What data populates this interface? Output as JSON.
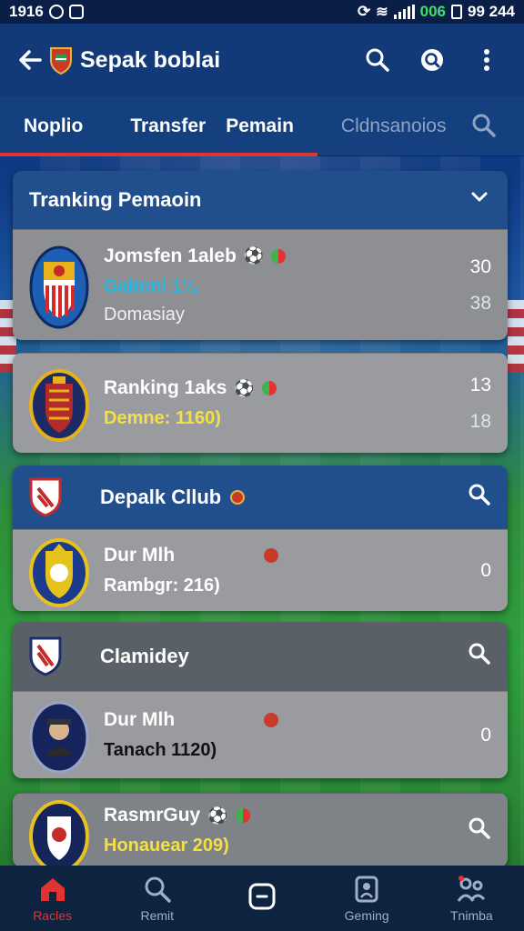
{
  "status_bar": {
    "time": "1916",
    "network": "006",
    "clock": "99 244"
  },
  "app_bar": {
    "title": "Sepak boblai"
  },
  "tabs": [
    {
      "label": "Noplio"
    },
    {
      "label": "Transfer"
    },
    {
      "label": "Pemain"
    },
    {
      "label": "Cldnsanoios"
    }
  ],
  "sections": {
    "ranking": {
      "title": "Tranking Pemaoin",
      "rows": [
        {
          "name": "Jomsfen 1aleb",
          "sub": "Gaitoni 1¼",
          "sub3": "Domasiay",
          "num1": "30",
          "num2": "38"
        },
        {
          "name": "Ranking 1aks",
          "sub": "Demne: 1160)",
          "num1": "13",
          "num2": "18"
        }
      ]
    },
    "club": {
      "title": "Depalk Cllub",
      "rows": [
        {
          "name": "Dur Mlh",
          "sub": "Rambgr: 216)",
          "num1": "0"
        }
      ]
    },
    "clamidey": {
      "title": "Clamidey",
      "rows": [
        {
          "name": "Dur Mlh",
          "sub": "Tanach 1120)",
          "num1": "0"
        }
      ]
    },
    "last": {
      "name": "RasmrGuy",
      "sub": "Honauear 209)"
    }
  },
  "bottom_nav": [
    {
      "label": "Racles"
    },
    {
      "label": "Remit"
    },
    {
      "label": ""
    },
    {
      "label": "Geming"
    },
    {
      "label": "Tnimba"
    }
  ],
  "colors": {
    "accent": "#e23333",
    "header_blue": "#214f8e",
    "card_gray": "#8d8f93"
  }
}
